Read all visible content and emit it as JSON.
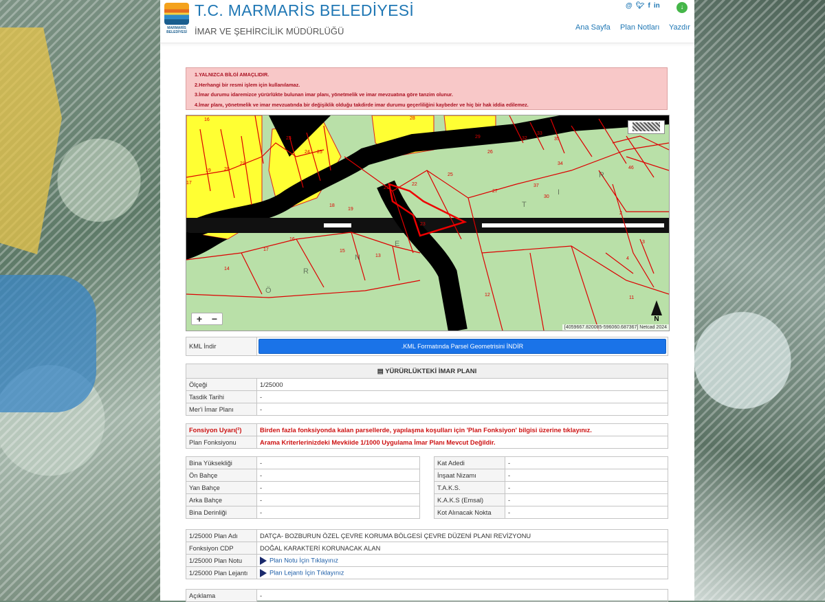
{
  "header": {
    "logo_text": "MARMARİS BELEDİYESİ",
    "title": "T.C. MARMARİS BELEDİYESİ",
    "subtitle": "İMAR VE ŞEHİRCİLİK MÜDÜRLÜĞÜ",
    "nav": [
      "Ana Sayfa",
      "Plan Notları",
      "Yazdır"
    ],
    "social_icons": [
      "email-icon",
      "twitter-icon",
      "facebook-icon",
      "linkedin-icon"
    ],
    "download_icon": "download-icon"
  },
  "warnings": [
    "1.YALNIZCA BİLGİ AMAÇLIDIR.",
    "2.Herhangi bir resmi işlem için kullanılamaz.",
    "3.İmar durumu idaremizce yürürlükte bulunan imar planı, yönetmelik ve imar mevzuatına göre tanzim olunur.",
    "4.İmar planı, yönetmelik ve imar mevzuatında bir değişiklik olduğu takdirde imar durumu geçerliliğini kaybeder ve hiç bir hak iddia edilemez."
  ],
  "map": {
    "zoom_in": "+",
    "zoom_out": "−",
    "north": "N",
    "coords": "[4059667.820085-596060.687367] Netcad 2024",
    "parcel_numbers": [
      "16",
      "23",
      "24",
      "25",
      "28",
      "29",
      "26",
      "32",
      "33",
      "35",
      "17",
      "19",
      "20",
      "21",
      "34",
      "46",
      "22",
      "25",
      "27",
      "37",
      "30",
      "18",
      "19",
      "21",
      "23",
      "16",
      "17",
      "15",
      "13",
      "14",
      "2",
      "3",
      "4",
      "12",
      "11"
    ],
    "street_letters": [
      "T",
      "I",
      "R",
      "Ö",
      "R",
      "N",
      "E"
    ]
  },
  "kml": {
    "label": "KML İndir",
    "button": ".KML Formatında Parsel Geometrisini İNDİR"
  },
  "plan": {
    "header": "YÜRÜRLÜKTEKİ İMAR PLANI",
    "rows": [
      {
        "label": "Ölçeği",
        "value": "1/25000"
      },
      {
        "label": "Tasdik Tarihi",
        "value": "-"
      },
      {
        "label": "Mer'i İmar Planı",
        "value": "-"
      }
    ]
  },
  "fonksiyon": {
    "warning_label": "Fonsiyon Uyarı(²)",
    "warning_text": "Birden fazla fonksiyonda kalan parsellerde, yapılaşma koşulları için 'Plan Fonksiyon' bilgisi üzerine tıklayınız.",
    "plan_label": "Plan Fonksiyonu",
    "plan_text": "Arama Kriterlerinizdeki Mevkiide 1/1000 Uygulama İmar Planı Mevcut Değildir."
  },
  "building_left": [
    {
      "label": "Bina Yüksekliği",
      "value": "-"
    },
    {
      "label": "Ön Bahçe",
      "value": "-"
    },
    {
      "label": "Yan Bahçe",
      "value": "-"
    },
    {
      "label": "Arka Bahçe",
      "value": "-"
    },
    {
      "label": "Bina Derinliği",
      "value": "-"
    }
  ],
  "building_right": [
    {
      "label": "Kat Adedi",
      "value": "-"
    },
    {
      "label": "İnşaat Nizamı",
      "value": "-"
    },
    {
      "label": "T.A.K.S.",
      "value": "-"
    },
    {
      "label": "K.A.K.S (Emsal)",
      "value": "-"
    },
    {
      "label": "Kot Alınacak Nokta",
      "value": "-"
    }
  ],
  "plan_info": [
    {
      "label": "1/25000 Plan Adı",
      "value": "DATÇA- BOZBURUN ÖZEL ÇEVRE KORUMA BÖLGESİ ÇEVRE DÜZENİ PLANI REVİZYONU"
    },
    {
      "label": "Fonksiyon CDP",
      "value": "DOĞAL KARAKTERİ KORUNACAK ALAN"
    },
    {
      "label": "1/25000 Plan Notu",
      "value": "Plan Notu İçin Tıklayınız"
    },
    {
      "label": "1/25000 Plan Lejantı",
      "value": "Plan Lejantı İçin Tıklayınız"
    }
  ],
  "aciklama": {
    "label": "Açıklama",
    "value": "-"
  }
}
